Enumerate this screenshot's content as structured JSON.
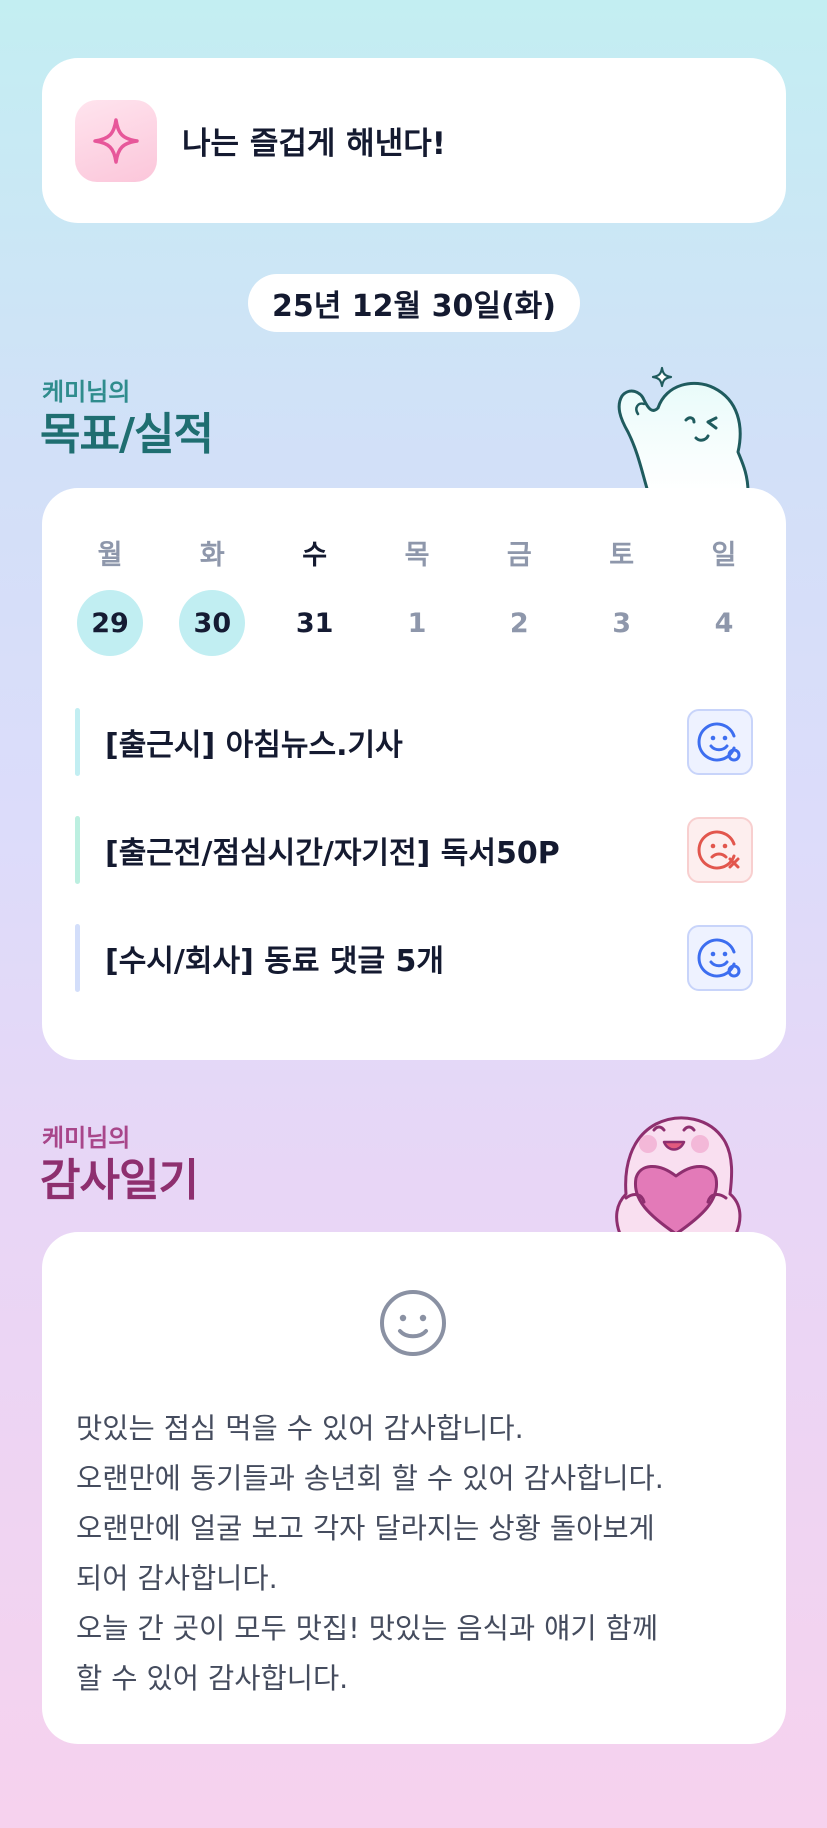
{
  "motto": {
    "text": "나는 즐겁게 해낸다!",
    "icon": "sparkle-icon"
  },
  "date": "25년 12월 30일(화)",
  "goals_section": {
    "subtitle": "케미님의",
    "title": "목표/실적"
  },
  "week": [
    {
      "day": "월",
      "num": "29",
      "state": "done"
    },
    {
      "day": "화",
      "num": "30",
      "state": "done"
    },
    {
      "day": "수",
      "num": "31",
      "state": "today"
    },
    {
      "day": "목",
      "num": "1",
      "state": "future"
    },
    {
      "day": "금",
      "num": "2",
      "state": "future"
    },
    {
      "day": "토",
      "num": "3",
      "state": "future"
    },
    {
      "day": "일",
      "num": "4",
      "state": "future"
    }
  ],
  "tasks": [
    {
      "label": "[출근시] 아침뉴스.기사",
      "status": "success",
      "bar_color": "#c2eef2"
    },
    {
      "label": "[출근전/점심시간/자기전] 독서50P",
      "status": "fail",
      "bar_color": "#bcefe0"
    },
    {
      "label": "[수시/회사] 동료 댓글 5개",
      "status": "success",
      "bar_color": "#d3defa"
    }
  ],
  "thanks_section": {
    "subtitle": "케미님의",
    "title": "감사일기"
  },
  "thanks_mood_icon": "smile-face-icon",
  "thanks_lines": [
    "맛있는 점심 먹을 수 있어 감사합니다.",
    "오랜만에 동기들과 송년회 할 수 있어 감사합니다.",
    "오랜만에 얼굴 보고 각자 달라지는 상황 돌아보게",
    "되어 감사합니다.",
    "오늘 간 곳이 모두 맛집! 맛있는 음식과 얘기 함께",
    "할 수 있어 감사합니다."
  ],
  "colors": {
    "goal_heading": "#1f6e71",
    "thanks_heading": "#8e2f6f",
    "done_day_bg": "#c1eef2",
    "success_icon": "#3d6ef0",
    "fail_icon": "#e2564d"
  }
}
